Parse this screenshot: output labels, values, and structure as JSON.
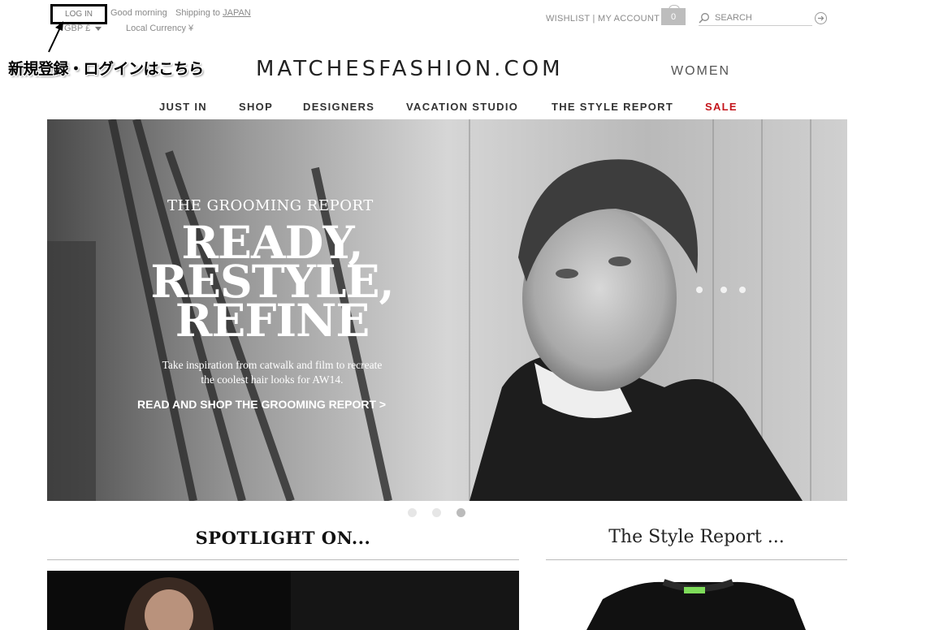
{
  "topbar": {
    "login": "LOG IN",
    "greeting": "Good morning",
    "shipping_prefix": "Shipping to",
    "shipping_country": "JAPAN",
    "currency_select": "GBP £",
    "local_currency": "Local Currency ¥",
    "annotation": "新規登録・ログインはこちら"
  },
  "util": {
    "wishlist": "WISHLIST |",
    "account": "MY ACCOUNT",
    "bag_count": "0",
    "search_placeholder": "SEARCH"
  },
  "brand": {
    "logo": "MATCHESFASHION.COM",
    "department": "WOMEN"
  },
  "nav": {
    "items": [
      "JUST IN",
      "SHOP",
      "DESIGNERS",
      "VACATION STUDIO",
      "THE STYLE REPORT",
      "SALE"
    ],
    "sale_color": "#c4161c"
  },
  "hero": {
    "kicker": "THE GROOMING REPORT",
    "headline_1": "READY,",
    "headline_2": "RESTYLE,",
    "headline_3": "REFINE",
    "body_1": "Take inspiration from catwalk and film to recreate",
    "body_2": "the coolest hair looks for AW14.",
    "cta": "READ AND SHOP THE GROOMING REPORT >",
    "slides": 3,
    "active_slide": 3
  },
  "sections": {
    "spotlight_title": "SPOTLIGHT ON...",
    "style_report_title": "The Style Report ..."
  }
}
